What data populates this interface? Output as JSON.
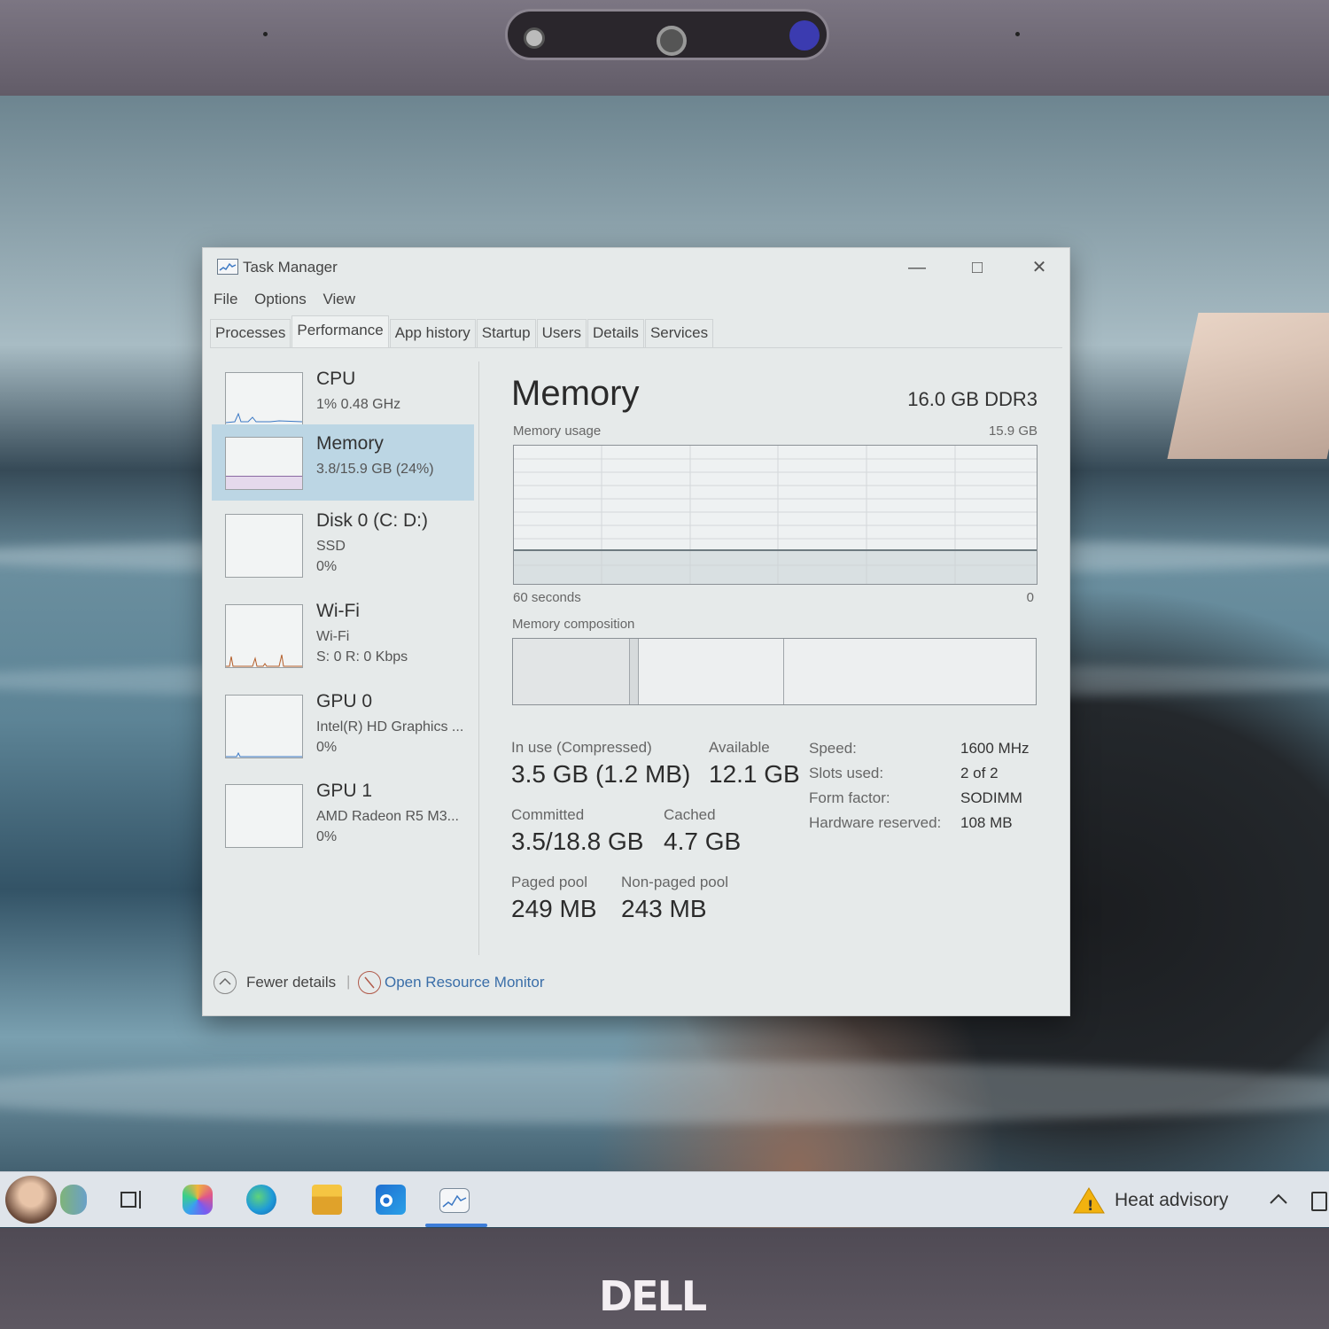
{
  "window": {
    "title": "Task Manager",
    "menu": [
      "File",
      "Options",
      "View"
    ],
    "tabs": [
      "Processes",
      "Performance",
      "App history",
      "Startup",
      "Users",
      "Details",
      "Services"
    ],
    "active_tab": "Performance"
  },
  "sidebar": {
    "items": [
      {
        "name": "CPU",
        "line1": "1%  0.48 GHz",
        "line2": ""
      },
      {
        "name": "Memory",
        "line1": "3.8/15.9 GB (24%)",
        "line2": ""
      },
      {
        "name": "Disk 0 (C: D:)",
        "line1": "SSD",
        "line2": "0%"
      },
      {
        "name": "Wi-Fi",
        "line1": "Wi-Fi",
        "line2": "S: 0  R: 0 Kbps"
      },
      {
        "name": "GPU 0",
        "line1": "Intel(R) HD Graphics ...",
        "line2": "0%"
      },
      {
        "name": "GPU 1",
        "line1": "AMD Radeon R5 M3...",
        "line2": "0%"
      }
    ]
  },
  "main": {
    "title": "Memory",
    "spec": "16.0 GB DDR3",
    "usage_label": "Memory usage",
    "usage_max": "15.9 GB",
    "time_left": "60 seconds",
    "time_right": "0",
    "composition_label": "Memory composition",
    "stats": {
      "in_use_label": "In use (Compressed)",
      "in_use_value": "3.5 GB (1.2 MB)",
      "available_label": "Available",
      "available_value": "12.1 GB",
      "committed_label": "Committed",
      "committed_value": "3.5/18.8 GB",
      "cached_label": "Cached",
      "cached_value": "4.7 GB",
      "paged_label": "Paged pool",
      "paged_value": "249 MB",
      "nonpaged_label": "Non-paged pool",
      "nonpaged_value": "243 MB"
    },
    "details": {
      "speed_key": "Speed:",
      "speed_val": "1600 MHz",
      "slots_key": "Slots used:",
      "slots_val": "2 of 2",
      "form_key": "Form factor:",
      "form_val": "SODIMM",
      "hw_key": "Hardware reserved:",
      "hw_val": "108 MB"
    },
    "memory_usage_fraction": 0.24
  },
  "footer": {
    "fewer_details": "Fewer details",
    "resource_monitor": "Open Resource Monitor"
  },
  "taskbar": {
    "weather": "Heat advisory",
    "icons": [
      "widgets-icon",
      "task-view-icon",
      "copilot-icon",
      "edge-icon",
      "file-explorer-icon",
      "outlook-icon",
      "task-manager-icon"
    ]
  },
  "bezel": {
    "logo": "DELL"
  }
}
